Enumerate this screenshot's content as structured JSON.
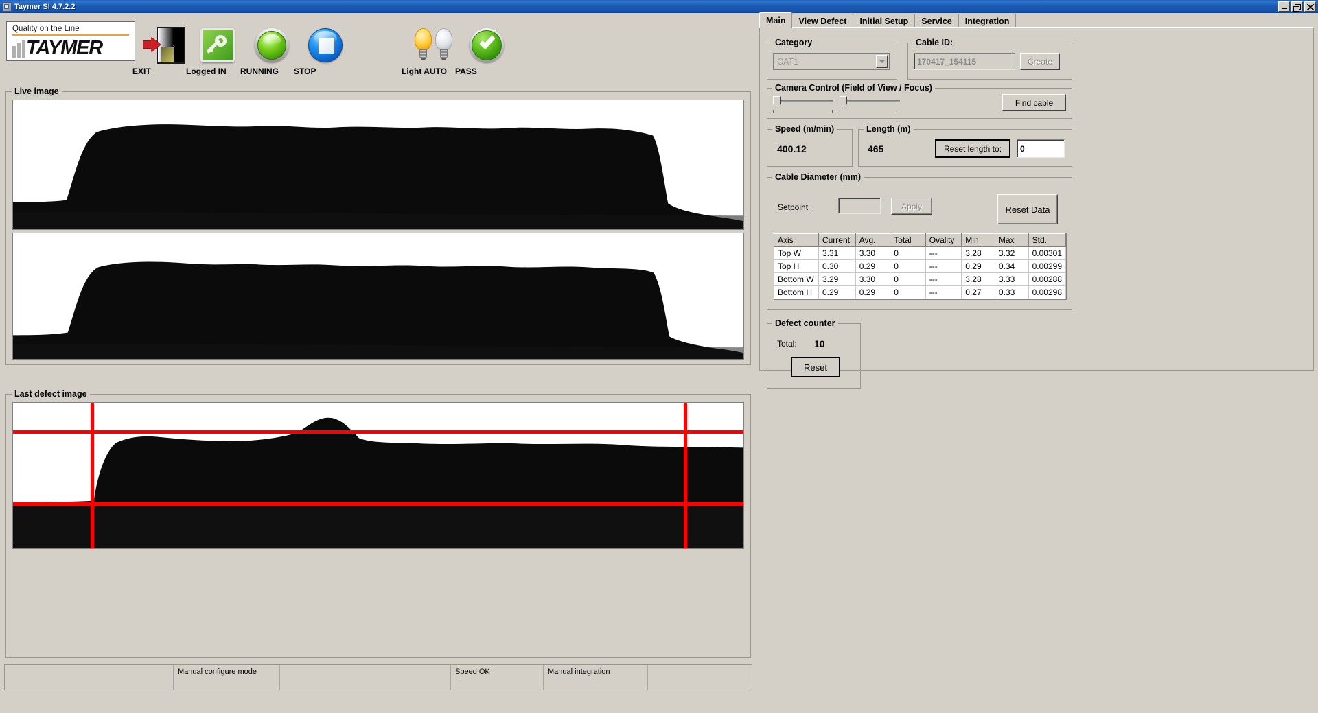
{
  "window": {
    "title": "Taymer SI 4.7.2.2",
    "icon": "app-icon",
    "minimize_label": "_",
    "maximize_label": "□",
    "close_label": "×"
  },
  "logo": {
    "tagline": "Quality on the Line",
    "brand": "TAYMER"
  },
  "toolbar": {
    "buttons": [
      {
        "label": "EXIT",
        "icon": "exit-door-icon"
      },
      {
        "label": "Logged IN",
        "icon": "key-icon"
      },
      {
        "label": "RUNNING",
        "icon": "green-lamp-icon"
      },
      {
        "label": "STOP",
        "icon": "blue-stop-icon"
      },
      {
        "label": "Light AUTO",
        "icon": "light-bulbs-icon"
      },
      {
        "label": "PASS",
        "icon": "green-check-icon"
      }
    ]
  },
  "panels": {
    "live_image_title": "Live image",
    "last_defect_title": "Last defect image"
  },
  "statusbar": {
    "cells": [
      "",
      "Manual configure mode",
      "",
      "Speed OK",
      "Manual integration",
      ""
    ]
  },
  "tabs": [
    {
      "label": "Main",
      "active": true
    },
    {
      "label": "View Defect",
      "active": false
    },
    {
      "label": "Initial Setup",
      "active": false
    },
    {
      "label": "Service",
      "active": false
    },
    {
      "label": "Integration",
      "active": false
    }
  ],
  "category": {
    "title": "Category",
    "value": "CAT1"
  },
  "cable_id": {
    "title": "Cable ID:",
    "value": "170417_154115",
    "create_label": "Create"
  },
  "camera_control": {
    "title": "Camera Control (Field of View / Focus)",
    "find_cable_label": "Find cable"
  },
  "speed": {
    "title": "Speed (m/min)",
    "value": "400.12"
  },
  "length": {
    "title": "Length (m)",
    "value": "465",
    "reset_label": "Reset length to:",
    "reset_value": "0"
  },
  "cable_diameter": {
    "title": "Cable Diameter (mm)",
    "setpoint_label": "Setpoint",
    "setpoint_value": "",
    "apply_label": "Apply",
    "reset_data_label": "Reset Data",
    "columns": [
      "Axis",
      "Current",
      "Avg.",
      "Total",
      "Ovality",
      "Min",
      "Max",
      "Std."
    ],
    "rows": [
      [
        "Top W",
        "3.31",
        "3.30",
        "0",
        "---",
        "3.28",
        "3.32",
        "0.00301"
      ],
      [
        "Top H",
        "0.30",
        "0.29",
        "0",
        "---",
        "0.29",
        "0.34",
        "0.00299"
      ],
      [
        "Bottom W",
        "3.29",
        "3.30",
        "0",
        "---",
        "3.28",
        "3.33",
        "0.00288"
      ],
      [
        "Bottom H",
        "0.29",
        "0.29",
        "0",
        "---",
        "0.27",
        "0.33",
        "0.00298"
      ]
    ]
  },
  "defect_counter": {
    "title": "Defect counter",
    "total_label": "Total:",
    "total_value": "10",
    "reset_label": "Reset"
  },
  "colors": {
    "crosshair": "#ff0000",
    "accent_orange": "#f0a030",
    "window_face": "#d4d0c8",
    "title_blue": "#1c5cb5"
  }
}
